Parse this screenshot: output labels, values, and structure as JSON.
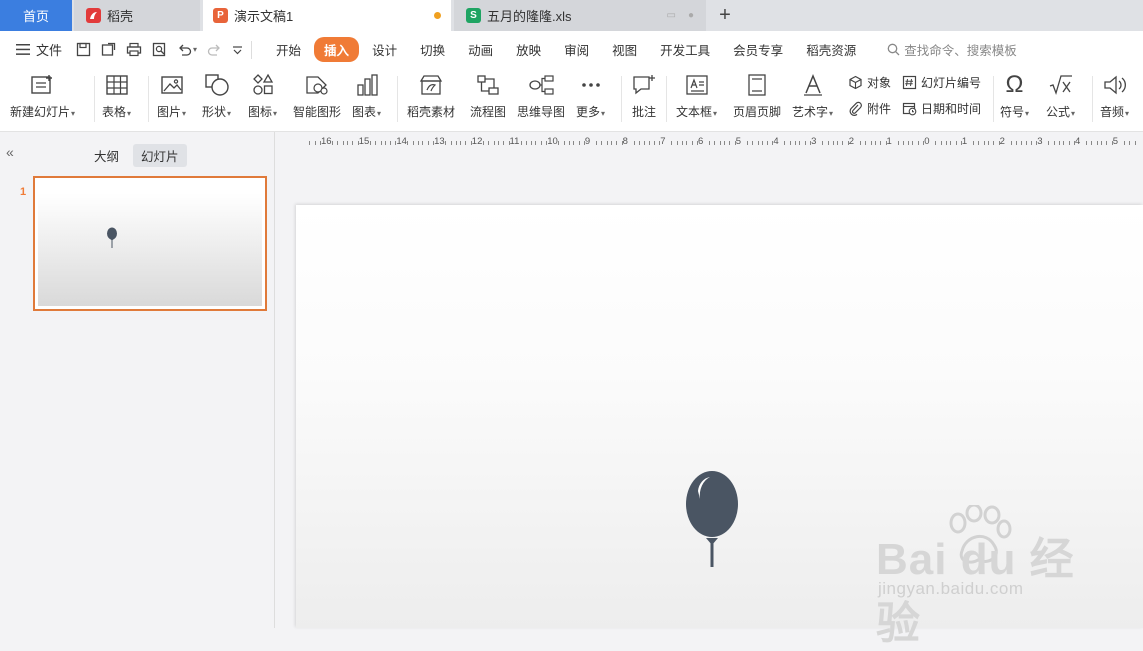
{
  "tabs": {
    "home": "首页",
    "daoke": "稻壳",
    "doc": "演示文稿1",
    "xls": "五月的隆隆.xls",
    "new_tab": "+"
  },
  "menu": {
    "file": "文件",
    "tabs": [
      "开始",
      "插入",
      "设计",
      "切换",
      "动画",
      "放映",
      "审阅",
      "视图",
      "开发工具",
      "会员专享",
      "稻壳资源"
    ],
    "active_tab": "插入",
    "search_placeholder": "查找命令、搜索模板"
  },
  "ribbon": {
    "new_slide": "新建幻灯片",
    "table": "表格",
    "picture": "图片",
    "shape": "形状",
    "icon": "图标",
    "smart_art": "智能图形",
    "chart": "图表",
    "daoke_material": "稻壳素材",
    "flowchart": "流程图",
    "mindmap": "思维导图",
    "more": "更多",
    "comment": "批注",
    "textbox": "文本框",
    "header_footer": "页眉页脚",
    "wordart": "艺术字",
    "object": "对象",
    "attachment": "附件",
    "slide_number": "幻灯片编号",
    "date_time": "日期和时间",
    "symbol": "符号",
    "formula": "公式",
    "audio": "音频"
  },
  "left_panel": {
    "outline": "大纲",
    "slides": "幻灯片",
    "slide_number": "1"
  },
  "ruler": [
    "16",
    "15",
    "14",
    "13",
    "12",
    "11",
    "10",
    "9",
    "8",
    "7",
    "6",
    "5",
    "4",
    "3",
    "2",
    "1",
    "0",
    "1",
    "2",
    "3",
    "4",
    "5"
  ],
  "watermark": {
    "text": "Bai du 经验",
    "url": "jingyan.baidu.com"
  },
  "colors": {
    "accent": "#f07b36",
    "home_tab": "#3b7ee0",
    "balloon": "#4a5563"
  }
}
